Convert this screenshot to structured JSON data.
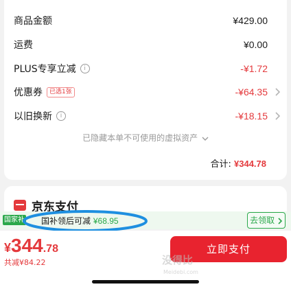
{
  "order_summary": {
    "rows": [
      {
        "label": "商品金额",
        "value": "¥429.00"
      },
      {
        "label": "运费",
        "value": "¥0.00"
      },
      {
        "label": "PLUS专享立减",
        "value": "-¥1.72"
      },
      {
        "label": "优惠券",
        "tag": "已选1张",
        "value": "-¥64.35"
      },
      {
        "label": "以旧换新",
        "value": "-¥18.15"
      }
    ],
    "hidden_note": "已隐藏本单不可使用的虚拟资产",
    "total_label": "合计:",
    "total_value": "¥344.78"
  },
  "payment": {
    "method_name": "京东支付"
  },
  "subsidy": {
    "badge": "国家补",
    "text": "国补领后可减",
    "amount": "¥68.95",
    "claim_label": "去领取"
  },
  "bottom": {
    "yen": "¥",
    "price_int": "344",
    "price_dec": ".78",
    "saved": "共减¥84.22",
    "pay_button": "立即支付"
  },
  "watermark": {
    "main": "没得比",
    "site": "Meidebi.com"
  },
  "colors": {
    "accent_red": "#e4393c",
    "subsidy_green": "#2aa84a",
    "highlight_blue": "#1e8fe0"
  }
}
